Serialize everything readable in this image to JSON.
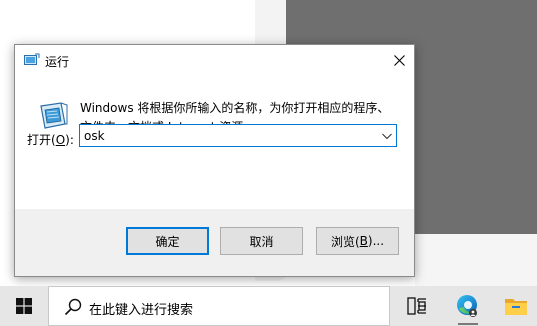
{
  "dialog": {
    "title": "运行",
    "icon": "run-icon",
    "description": "Windows 将根据你所输入的名称，为你打开相应的程序、\n文件夹、文档或 Internet 资源。",
    "open_label_prefix": "打开(",
    "open_label_accel": "O",
    "open_label_suffix": "):",
    "input_value": "osk",
    "buttons": {
      "ok": "确定",
      "cancel": "取消",
      "browse_prefix": "浏览(",
      "browse_accel": "B",
      "browse_suffix": ")..."
    }
  },
  "taskbar": {
    "search_placeholder": "在此键入进行搜索",
    "icons": [
      "windows-start-icon",
      "search-icon",
      "task-view-icon",
      "edge-icon",
      "file-explorer-icon"
    ]
  },
  "colors": {
    "accent": "#0078d7",
    "dialog_bg": "#f0f0f0",
    "taskbar_bg": "#e6e6e6",
    "button_bg": "#e1e1e1"
  }
}
